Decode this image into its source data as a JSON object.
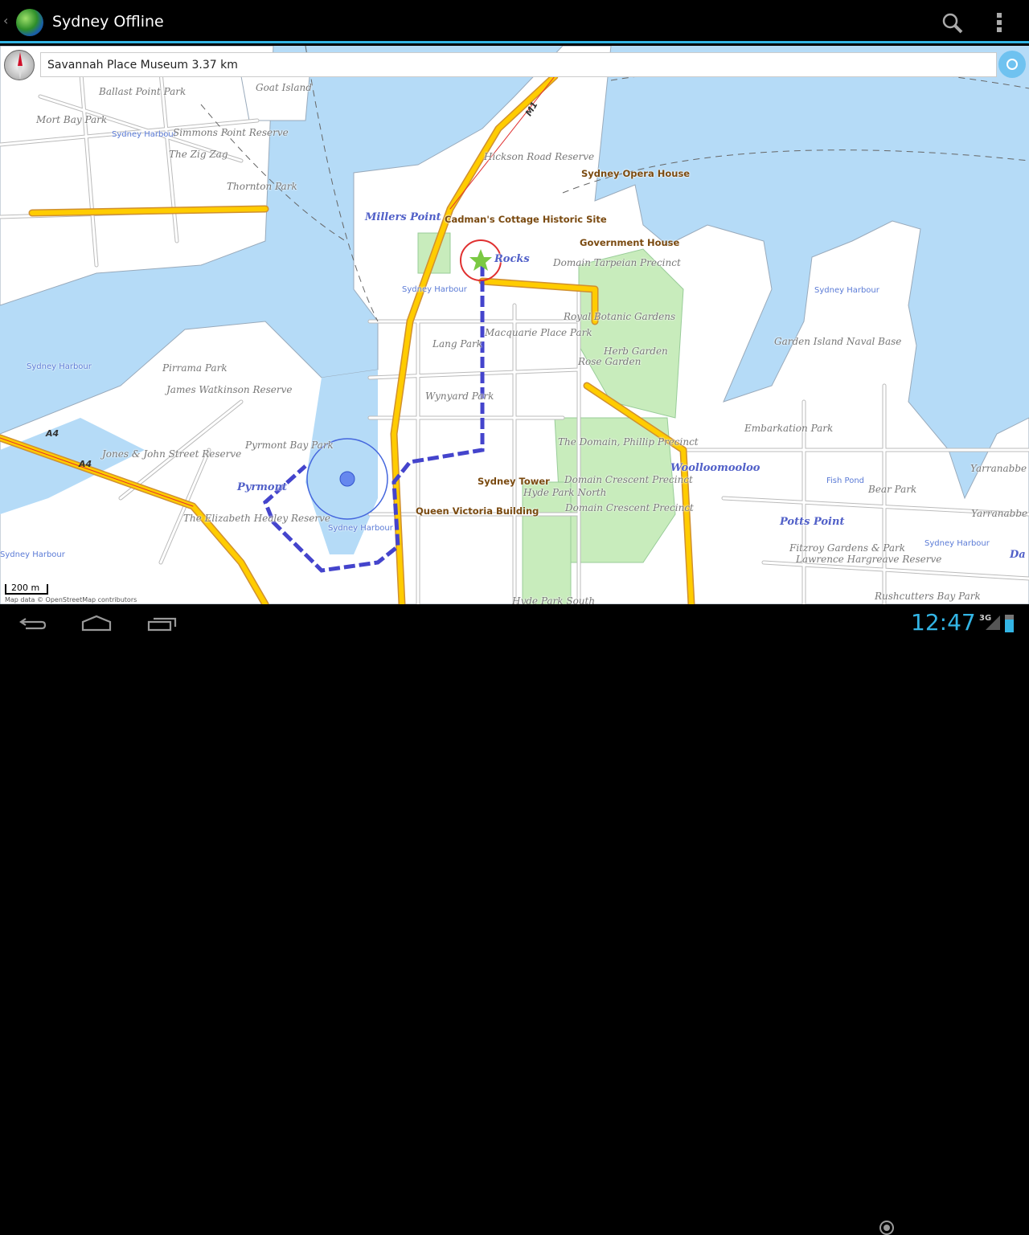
{
  "app": {
    "title": "Sydney Offline",
    "back_icon": "chevron-left-icon",
    "logo_icon": "globe-icon"
  },
  "actions": {
    "search_icon": "search-icon",
    "menu_icon": "overflow-menu-icon"
  },
  "info_bar": {
    "text": "Savannah Place Museum 3.37 km"
  },
  "map": {
    "colors": {
      "water": "#b5dbf7",
      "land": "#ffffff",
      "park": "#c8ecbc",
      "motorway": "#ffcc00",
      "route": "#4444cc"
    },
    "labels": [
      "Goat Island",
      "Ballast Point Park",
      "Mort Bay Park",
      "Sydney Harbour",
      "Simmons Point Reserve",
      "The Zig Zag",
      "Thornton Park",
      "Hickson Road Reserve",
      "Sydney Opera House",
      "Millers Point",
      "Cadman's Cottage Historic Site",
      "Government House",
      "Rocks",
      "Domain Tarpeian Precinct",
      "Sydney Harbour",
      "Sydney Harbour",
      "Royal Botanic Gardens",
      "Macquarie Place Park",
      "Lang Park",
      "Garden Island Naval Base",
      "Herb Garden",
      "Rose Garden",
      "Sydney Harbour",
      "Pirrama Park",
      "James Watkinson Reserve",
      "Wynyard Park",
      "Embarkation Park",
      "The Domain, Phillip Precinct",
      "Pyrmont Bay Park",
      "Jones & John Street Reserve",
      "Woolloomooloo",
      "Yarranabbe P",
      "Sydney Tower",
      "Domain Crescent Precinct",
      "Fish Pond",
      "Pyrmont",
      "Bear Park",
      "Hyde Park North",
      "Queen Victoria Building",
      "Domain Crescent Precinct",
      "Yarranabbe",
      "The Elizabeth Healey Reserve",
      "Potts Point",
      "Sydney Harbour",
      "Sydney Harbour",
      "Fitzroy Gardens & Park",
      "Lawrence Hargreave Reserve",
      "Sydney Harbour",
      "Rushcutters Bay Park",
      "Hyde Park South",
      "Da"
    ],
    "shields": [
      "A4",
      "A4",
      "M1"
    ],
    "scale": "200 m",
    "attribution": "Map data © OpenStreetMap contributors"
  },
  "navbar": {
    "back": "back-icon",
    "home": "home-icon",
    "recents": "recent-apps-icon"
  },
  "status": {
    "time": "12:47",
    "network": "3G"
  }
}
